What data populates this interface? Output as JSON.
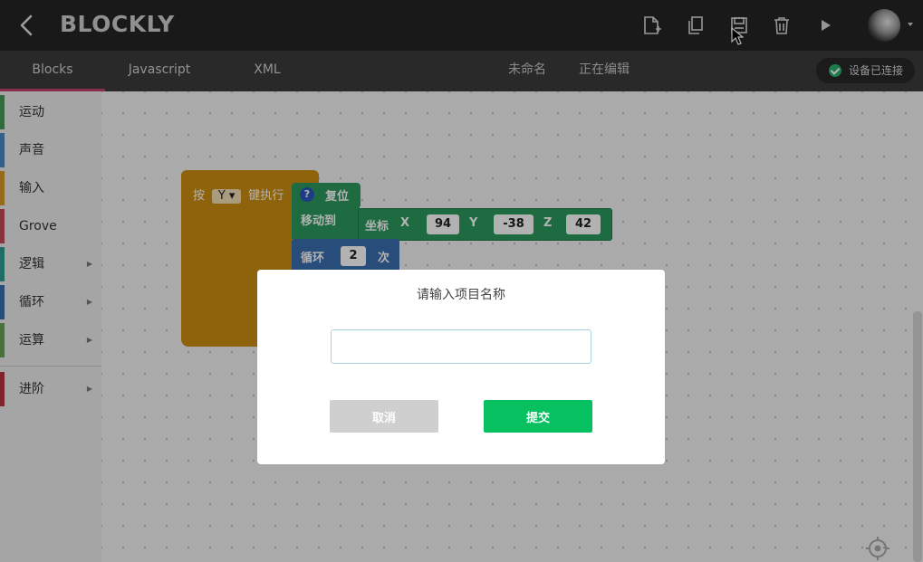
{
  "app": {
    "title": "BLOCKLY"
  },
  "toolbar": {
    "icons": [
      "back-icon",
      "new-file-icon",
      "copy-icon",
      "save-icon",
      "delete-icon",
      "run-icon",
      "avatar"
    ]
  },
  "tabs": [
    {
      "label": "Blocks",
      "active": true
    },
    {
      "label": "Javascript",
      "active": false
    },
    {
      "label": "XML",
      "active": false
    }
  ],
  "project": {
    "name": "未命名",
    "status": "正在编辑"
  },
  "connection": {
    "label": "设备已连接",
    "color": "#2ab26b"
  },
  "sidebar": {
    "categories": [
      {
        "label": "运动",
        "color": "#4a9a5a",
        "has_children": false
      },
      {
        "label": "声音",
        "color": "#4a88c5",
        "has_children": false
      },
      {
        "label": "输入",
        "color": "#d79a25",
        "has_children": false
      },
      {
        "label": "Grove",
        "color": "#c3495a",
        "has_children": false
      },
      {
        "label": "逻辑",
        "color": "#2f9c93",
        "has_children": true
      },
      {
        "label": "循环",
        "color": "#3a6fb0",
        "has_children": true
      },
      {
        "label": "运算",
        "color": "#6aa15a",
        "has_children": true
      },
      {
        "label": "进阶",
        "color": "#b8363f",
        "has_children": true
      }
    ]
  },
  "blocks": {
    "hat": {
      "prefix": "按",
      "key": "Y",
      "suffix": "键执行"
    },
    "reset": {
      "help": "?",
      "label": "复位"
    },
    "move": {
      "label": "移动到",
      "coord_label": "坐标",
      "x_label": "X",
      "x": "94",
      "y_label": "Y",
      "y": "-38",
      "z_label": "Z",
      "z": "42"
    },
    "loop": {
      "label": "循环",
      "count": "2",
      "suffix": "次"
    }
  },
  "dialog": {
    "title": "请输入项目名称",
    "input_value": "",
    "cancel_label": "取消",
    "submit_label": "提交"
  },
  "colors": {
    "accent": "#c2406a",
    "submit": "#07c160",
    "event_block": "#cd8e12",
    "motion_block": "#2b9a5d",
    "loop_block": "#3a6fb0"
  }
}
